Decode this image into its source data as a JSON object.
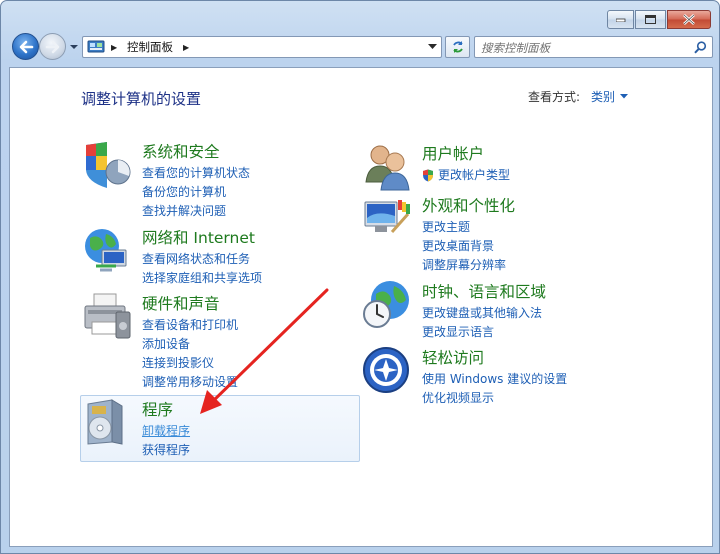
{
  "address": {
    "path_label": "控制面板"
  },
  "search": {
    "placeholder": "搜索控制面板"
  },
  "header": {
    "title": "调整计算机的设置",
    "viewby_label": "查看方式:",
    "viewby_value": "类别"
  },
  "categories": {
    "system": {
      "title": "系统和安全",
      "links": [
        "查看您的计算机状态",
        "备份您的计算机",
        "查找并解决问题"
      ]
    },
    "network": {
      "title": "网络和 Internet",
      "links": [
        "查看网络状态和任务",
        "选择家庭组和共享选项"
      ]
    },
    "hardware": {
      "title": "硬件和声音",
      "links": [
        "查看设备和打印机",
        "添加设备",
        "连接到投影仪",
        "调整常用移动设置"
      ]
    },
    "programs": {
      "title": "程序",
      "links": [
        "卸载程序",
        "获得程序"
      ]
    },
    "users": {
      "title": "用户帐户",
      "links": [
        "更改帐户类型"
      ]
    },
    "appearance": {
      "title": "外观和个性化",
      "links": [
        "更改主题",
        "更改桌面背景",
        "调整屏幕分辨率"
      ]
    },
    "clock": {
      "title": "时钟、语言和区域",
      "links": [
        "更改键盘或其他输入法",
        "更改显示语言"
      ]
    },
    "ease": {
      "title": "轻松访问",
      "links": [
        "使用 Windows 建议的设置",
        "优化视频显示"
      ]
    }
  },
  "colors": {
    "title_blue": "#1e3287",
    "category_green": "#1e7a1e",
    "link_blue": "#1e5fb5",
    "annotation_red": "#e52420"
  }
}
